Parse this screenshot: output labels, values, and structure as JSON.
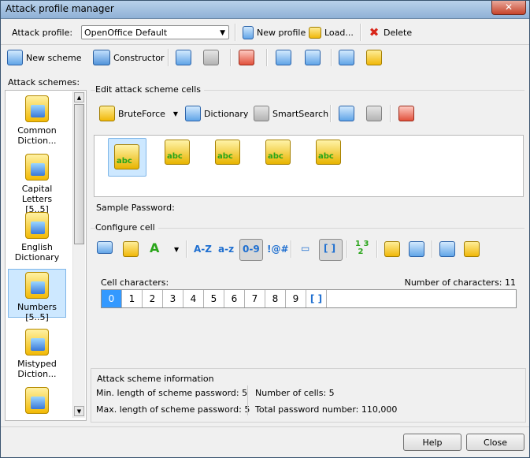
{
  "window": {
    "title": "Attack profile manager",
    "close_glyph": "✕"
  },
  "profile_bar": {
    "label": "Attack profile:",
    "selected": "OpenOffice Default",
    "new_profile": "New profile",
    "load": "Load...",
    "delete": "Delete"
  },
  "main_toolbar": {
    "new_scheme": "New scheme",
    "constructor": "Constructor"
  },
  "schemes": {
    "label": "Attack schemes:",
    "items": [
      {
        "line1": "Common",
        "line2": "Diction..."
      },
      {
        "line1": "Capital Letters",
        "line2": "[5..5]"
      },
      {
        "line1": "English",
        "line2": "Dictionary"
      },
      {
        "line1": "Numbers",
        "line2": "[5..5]"
      },
      {
        "line1": "Mistyped",
        "line2": "Diction..."
      }
    ],
    "selected_index": 3
  },
  "edit_cells": {
    "title": "Edit attack scheme cells",
    "bruteforce": "BruteForce",
    "dictionary": "Dictionary",
    "smartsearch": "SmartSearch",
    "cell_icon_text": "abc",
    "sample_label": "Sample Password:"
  },
  "configure": {
    "title": "Configure cell",
    "az": "A-Z",
    "az_lower": "a-z",
    "digits": "0-9",
    "special": "!@#",
    "cell_chars_label": "Cell characters:",
    "num_chars_label": "Number of characters: 11",
    "chars": [
      "0",
      "1",
      "2",
      "3",
      "4",
      "5",
      "6",
      "7",
      "8",
      "9",
      "[ ]"
    ]
  },
  "info": {
    "title": "Attack scheme information",
    "min_len": "Min. length of scheme password: 5",
    "max_len": "Max. length of scheme password: 5",
    "num_cells": "Number of cells: 5",
    "total": "Total password number: 110,000"
  },
  "footer": {
    "help": "Help",
    "close": "Close"
  }
}
